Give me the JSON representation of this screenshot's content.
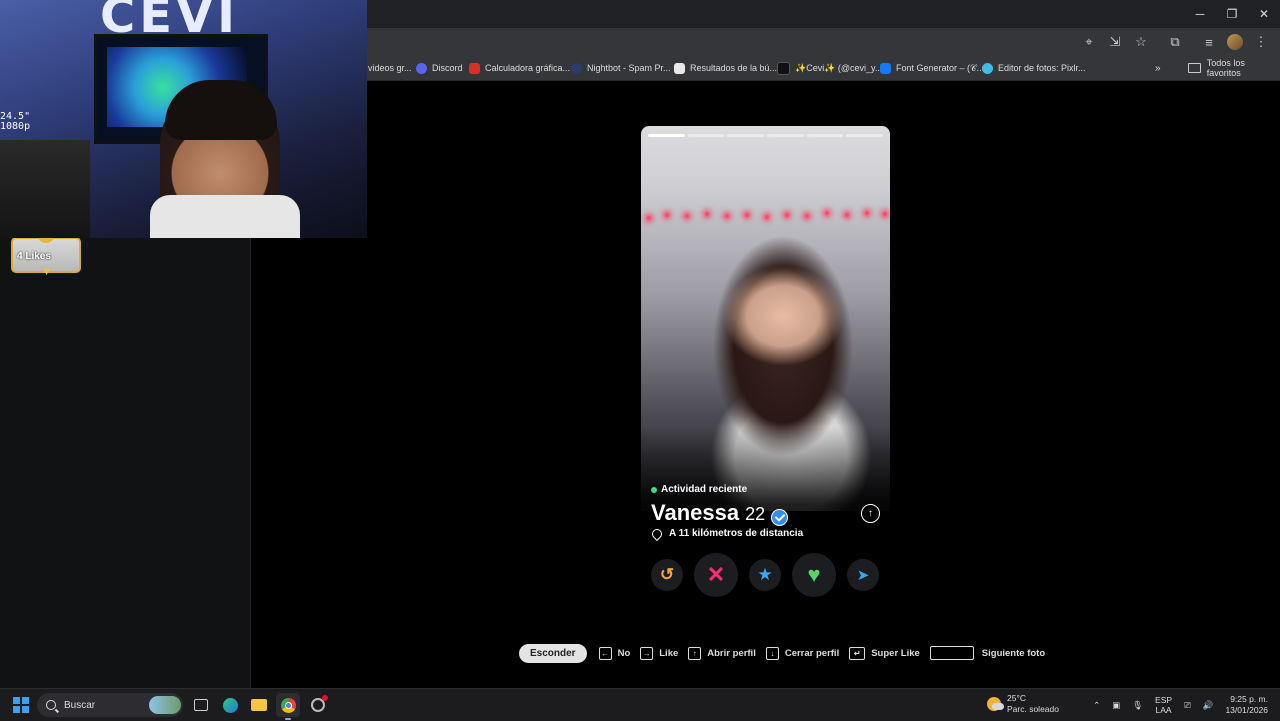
{
  "browser": {
    "bookmarks": [
      {
        "label": "videos gr...",
        "color": "#e4e4e4"
      },
      {
        "label": "Discord",
        "color": "#5865f2"
      },
      {
        "label": "Calculadora gráfica...",
        "color": "#d93025"
      },
      {
        "label": "Nightbot - Spam Pr...",
        "color": "#2b3b6e"
      },
      {
        "label": "Resultados de la bú...",
        "color": "#e8e8e8"
      },
      {
        "label": "✨Cevi✨ (@cevi_y...",
        "color": "#111111"
      },
      {
        "label": "Font Generator – (𝒞...",
        "color": "#1877f2"
      },
      {
        "label": "Editor de fotos: Pixlr...",
        "color": "#3fbde8"
      }
    ],
    "all_bookmarks": "Todos los favoritos"
  },
  "left_panel": {
    "likes_label": "4 Likes"
  },
  "webcam": {
    "logo_text": "CEVI",
    "monitor_text_line1": "24.5\"",
    "monitor_text_line2": "1080p"
  },
  "profile": {
    "activity": "Actividad reciente",
    "name": "Vanessa",
    "age": "22",
    "distance": "A 11 kilómetros de distancia",
    "photo_count": 6,
    "current_photo": 1
  },
  "actions": {
    "rewind": "↺",
    "nope": "✕",
    "superlike": "★",
    "like": "♥",
    "boost": "➤"
  },
  "hints": {
    "hide_button": "Esconder",
    "no": "No",
    "like": "Like",
    "open_profile": "Abrir perfil",
    "close_profile": "Cerrar perfil",
    "super_like": "Super Like",
    "next_photo": "Siguiente foto"
  },
  "taskbar": {
    "search_placeholder": "Buscar",
    "weather_temp": "25°C",
    "weather_desc": "Parc. soleado",
    "lang_1": "ESP",
    "lang_2": "LAA",
    "time": "9:25 p. m.",
    "date": "13/01/2026"
  },
  "colors": {
    "rewind": "#f2a93b",
    "nope": "#ff2d6f",
    "superlike": "#3aa6ff",
    "like": "#5ad36a",
    "boost": "#35a8f5"
  }
}
